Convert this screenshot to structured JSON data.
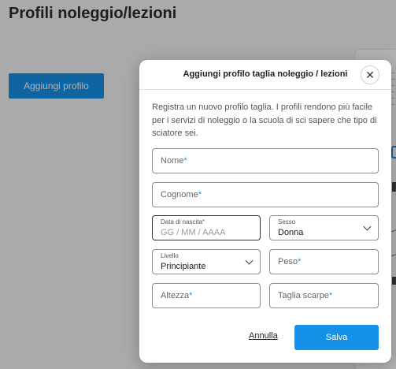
{
  "page": {
    "title": "Profili noleggio/lezioni",
    "add_button_label": "Aggiungi profilo"
  },
  "modal": {
    "title": "Aggiungi profilo taglia noleggio / lezioni",
    "close_icon": "close-icon",
    "description": "Registra un nuovo profilo taglia. I profili rendono più facile per i servizi di noleggio o la scuola di sci sapere che tipo di sciatore sei.",
    "fields": {
      "nome": {
        "label": "Nome",
        "required_mark": "*"
      },
      "cognome": {
        "label": "Cognome",
        "required_mark": "*"
      },
      "data_nascita": {
        "label": "Data di nascita",
        "required_mark": "*",
        "placeholder": "GG  /  MM  /  AAAA"
      },
      "sesso": {
        "label": "Sesso",
        "value": "Donna"
      },
      "livello": {
        "label": "Livello",
        "value": "Principiante"
      },
      "peso": {
        "label": "Peso",
        "required_mark": "*"
      },
      "altezza": {
        "label": "Altezza",
        "required_mark": "*"
      },
      "taglia_scarpe": {
        "label": "Taglia scarpe",
        "required_mark": "*"
      }
    },
    "cancel_label": "Annulla",
    "save_label": "Salva"
  },
  "colors": {
    "accent": "#1591e8",
    "overlay": "rgba(0,0,0,0.30)"
  }
}
